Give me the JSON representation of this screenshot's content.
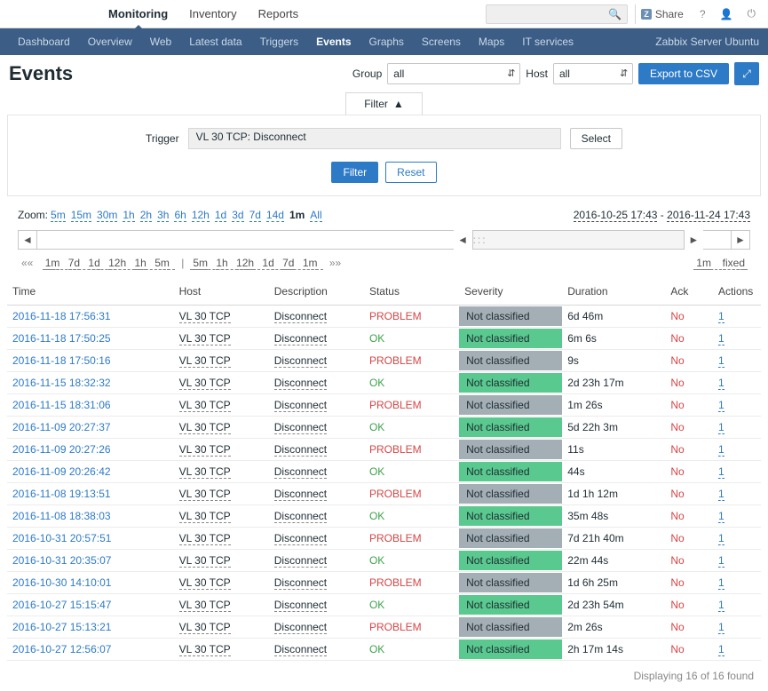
{
  "top_nav": {
    "items": [
      "Monitoring",
      "Inventory",
      "Reports"
    ],
    "active": 0,
    "share": "Share",
    "icons": [
      "help",
      "user",
      "power"
    ]
  },
  "sub_nav": {
    "items": [
      "Dashboard",
      "Overview",
      "Web",
      "Latest data",
      "Triggers",
      "Events",
      "Graphs",
      "Screens",
      "Maps",
      "IT services"
    ],
    "active": 5,
    "server": "Zabbix Server Ubuntu"
  },
  "header": {
    "title": "Events",
    "group_lbl": "Group",
    "group_val": "all",
    "host_lbl": "Host",
    "host_val": "all",
    "export": "Export to CSV"
  },
  "filter": {
    "tab": "Filter",
    "trigger_lbl": "Trigger",
    "trigger_val": "VL 30 TCP: Disconnect",
    "select": "Select",
    "apply": "Filter",
    "reset": "Reset"
  },
  "zoom": {
    "label": "Zoom:",
    "items": [
      "5m",
      "15m",
      "30m",
      "1h",
      "2h",
      "3h",
      "6h",
      "12h",
      "1d",
      "3d",
      "7d",
      "14d",
      "1m",
      "All"
    ],
    "active": 12,
    "date_from": "2016-10-25 17:43",
    "date_to": "2016-11-24 17:43"
  },
  "quick": {
    "left_pre": "«« ",
    "left": [
      "1m",
      "7d",
      "1d",
      "12h",
      "1h",
      "5m"
    ],
    "right": [
      "5m",
      "1h",
      "12h",
      "1d",
      "7d",
      "1m"
    ],
    "right_post": " »»",
    "r_val": "1m",
    "r_fix": "fixed"
  },
  "columns": [
    "Time",
    "Host",
    "Description",
    "Status",
    "Severity",
    "Duration",
    "Ack",
    "Actions"
  ],
  "rows": [
    {
      "t": "2016-11-18 17:56:31",
      "h": "VL 30 TCP",
      "d": "Disconnect",
      "s": "PROBLEM",
      "v": "Not classified",
      "du": "6d 46m",
      "ak": "No",
      "ac": "1"
    },
    {
      "t": "2016-11-18 17:50:25",
      "h": "VL 30 TCP",
      "d": "Disconnect",
      "s": "OK",
      "v": "Not classified",
      "du": "6m 6s",
      "ak": "No",
      "ac": "1"
    },
    {
      "t": "2016-11-18 17:50:16",
      "h": "VL 30 TCP",
      "d": "Disconnect",
      "s": "PROBLEM",
      "v": "Not classified",
      "du": "9s",
      "ak": "No",
      "ac": "1"
    },
    {
      "t": "2016-11-15 18:32:32",
      "h": "VL 30 TCP",
      "d": "Disconnect",
      "s": "OK",
      "v": "Not classified",
      "du": "2d 23h 17m",
      "ak": "No",
      "ac": "1"
    },
    {
      "t": "2016-11-15 18:31:06",
      "h": "VL 30 TCP",
      "d": "Disconnect",
      "s": "PROBLEM",
      "v": "Not classified",
      "du": "1m 26s",
      "ak": "No",
      "ac": "1"
    },
    {
      "t": "2016-11-09 20:27:37",
      "h": "VL 30 TCP",
      "d": "Disconnect",
      "s": "OK",
      "v": "Not classified",
      "du": "5d 22h 3m",
      "ak": "No",
      "ac": "1"
    },
    {
      "t": "2016-11-09 20:27:26",
      "h": "VL 30 TCP",
      "d": "Disconnect",
      "s": "PROBLEM",
      "v": "Not classified",
      "du": "11s",
      "ak": "No",
      "ac": "1"
    },
    {
      "t": "2016-11-09 20:26:42",
      "h": "VL 30 TCP",
      "d": "Disconnect",
      "s": "OK",
      "v": "Not classified",
      "du": "44s",
      "ak": "No",
      "ac": "1"
    },
    {
      "t": "2016-11-08 19:13:51",
      "h": "VL 30 TCP",
      "d": "Disconnect",
      "s": "PROBLEM",
      "v": "Not classified",
      "du": "1d 1h 12m",
      "ak": "No",
      "ac": "1"
    },
    {
      "t": "2016-11-08 18:38:03",
      "h": "VL 30 TCP",
      "d": "Disconnect",
      "s": "OK",
      "v": "Not classified",
      "du": "35m 48s",
      "ak": "No",
      "ac": "1"
    },
    {
      "t": "2016-10-31 20:57:51",
      "h": "VL 30 TCP",
      "d": "Disconnect",
      "s": "PROBLEM",
      "v": "Not classified",
      "du": "7d 21h 40m",
      "ak": "No",
      "ac": "1"
    },
    {
      "t": "2016-10-31 20:35:07",
      "h": "VL 30 TCP",
      "d": "Disconnect",
      "s": "OK",
      "v": "Not classified",
      "du": "22m 44s",
      "ak": "No",
      "ac": "1"
    },
    {
      "t": "2016-10-30 14:10:01",
      "h": "VL 30 TCP",
      "d": "Disconnect",
      "s": "PROBLEM",
      "v": "Not classified",
      "du": "1d 6h 25m",
      "ak": "No",
      "ac": "1"
    },
    {
      "t": "2016-10-27 15:15:47",
      "h": "VL 30 TCP",
      "d": "Disconnect",
      "s": "OK",
      "v": "Not classified",
      "du": "2d 23h 54m",
      "ak": "No",
      "ac": "1"
    },
    {
      "t": "2016-10-27 15:13:21",
      "h": "VL 30 TCP",
      "d": "Disconnect",
      "s": "PROBLEM",
      "v": "Not classified",
      "du": "2m 26s",
      "ak": "No",
      "ac": "1"
    },
    {
      "t": "2016-10-27 12:56:07",
      "h": "VL 30 TCP",
      "d": "Disconnect",
      "s": "OK",
      "v": "Not classified",
      "du": "2h 17m 14s",
      "ak": "No",
      "ac": "1"
    }
  ],
  "footer": "Displaying 16 of 16 found"
}
